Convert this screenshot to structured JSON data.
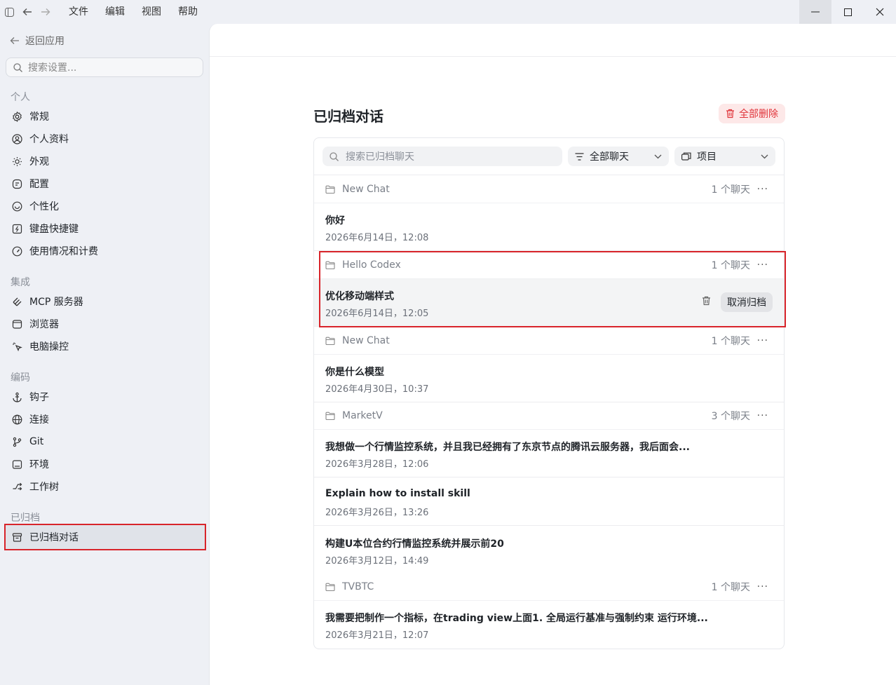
{
  "menu": [
    "文件",
    "编辑",
    "视图",
    "帮助"
  ],
  "sidebar": {
    "back_label": "返回应用",
    "search_placeholder": "搜索设置...",
    "groups": [
      {
        "title": "个人",
        "items": [
          {
            "label": "常规",
            "icon": "gear-icon"
          },
          {
            "label": "个人资料",
            "icon": "user-circle-icon"
          },
          {
            "label": "外观",
            "icon": "sun-icon"
          },
          {
            "label": "配置",
            "icon": "config-icon"
          },
          {
            "label": "个性化",
            "icon": "personalize-icon"
          },
          {
            "label": "键盘快捷键",
            "icon": "keyboard-icon"
          },
          {
            "label": "使用情况和计费",
            "icon": "gauge-icon"
          }
        ]
      },
      {
        "title": "集成",
        "items": [
          {
            "label": "MCP 服务器",
            "icon": "mcp-icon"
          },
          {
            "label": "浏览器",
            "icon": "browser-icon"
          },
          {
            "label": "电脑操控",
            "icon": "cursor-icon"
          }
        ]
      },
      {
        "title": "编码",
        "items": [
          {
            "label": "钩子",
            "icon": "anchor-icon"
          },
          {
            "label": "连接",
            "icon": "globe-icon"
          },
          {
            "label": "Git",
            "icon": "git-icon"
          },
          {
            "label": "环境",
            "icon": "terminal-icon"
          },
          {
            "label": "工作树",
            "icon": "worktree-icon"
          }
        ]
      },
      {
        "title": "已归档",
        "items": [
          {
            "label": "已归档对话",
            "icon": "archive-icon",
            "active": true
          }
        ]
      }
    ]
  },
  "main": {
    "title": "已归档对话",
    "delete_all_label": "全部删除",
    "search_placeholder": "搜索已归档聊天",
    "filter_all_label": "全部聊天",
    "filter_project_label": "项目",
    "unarchive_label": "取消归档",
    "projects": [
      {
        "name": "New Chat",
        "count": "1 个聊天",
        "chats": [
          {
            "title": "你好",
            "date": "2026年6月14日，12:08"
          }
        ]
      },
      {
        "name": "Hello Codex",
        "count": "1 个聊天",
        "chats": [
          {
            "title": "优化移动端样式",
            "date": "2026年6月14日，12:05",
            "hovered": true
          }
        ]
      },
      {
        "name": "New Chat",
        "count": "1 个聊天",
        "chats": [
          {
            "title": "你是什么模型",
            "date": "2026年4月30日，10:37"
          }
        ]
      },
      {
        "name": "MarketV",
        "count": "3 个聊天",
        "chats": [
          {
            "title": "我想做一个行情监控系统，并且我已经拥有了东京节点的腾讯云服务器，我后面会...",
            "date": "2026年3月28日，12:06"
          },
          {
            "title": "Explain how to install skill",
            "date": "2026年3月26日，13:26"
          },
          {
            "title": "构建U本位合约行情监控系统并展示前20",
            "date": "2026年3月12日，14:49"
          }
        ]
      },
      {
        "name": "TVBTC",
        "count": "1 个聊天",
        "chats": [
          {
            "title": "我需要把制作一个指标，在trading view上面1. 全局运行基准与强制约束 运行环境...",
            "date": "2026年3月21日，12:07"
          }
        ]
      }
    ]
  }
}
